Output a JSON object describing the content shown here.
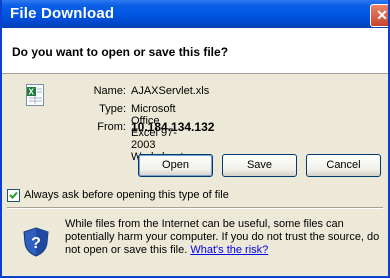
{
  "window": {
    "title": "File Download",
    "close_glyph": "✕"
  },
  "dialog": {
    "question": "Do you want to open or save this file?",
    "file": {
      "icon": "excel-file-icon",
      "name_label": "Name:",
      "name_value": "AJAXServlet.xls",
      "type_label": "Type:",
      "type_value": "Microsoft Office Excel 97-2003 Worksheet",
      "from_label": "From:",
      "from_value": "10.184.134.132"
    },
    "buttons": {
      "open": "Open",
      "save": "Save",
      "cancel": "Cancel"
    },
    "always_ask": {
      "label": "Always ask before opening this type of file",
      "checked": true
    },
    "warning": {
      "icon": "shield-question-icon",
      "text": "While files from the Internet can be useful, some files can potentially harm your computer. If you do not trust the source, do not open or save this file. ",
      "link": "What's the risk?"
    }
  },
  "colors": {
    "title_bar": "#0054e3",
    "dialog_bg": "#ece9d8",
    "link": "#0000ee"
  }
}
